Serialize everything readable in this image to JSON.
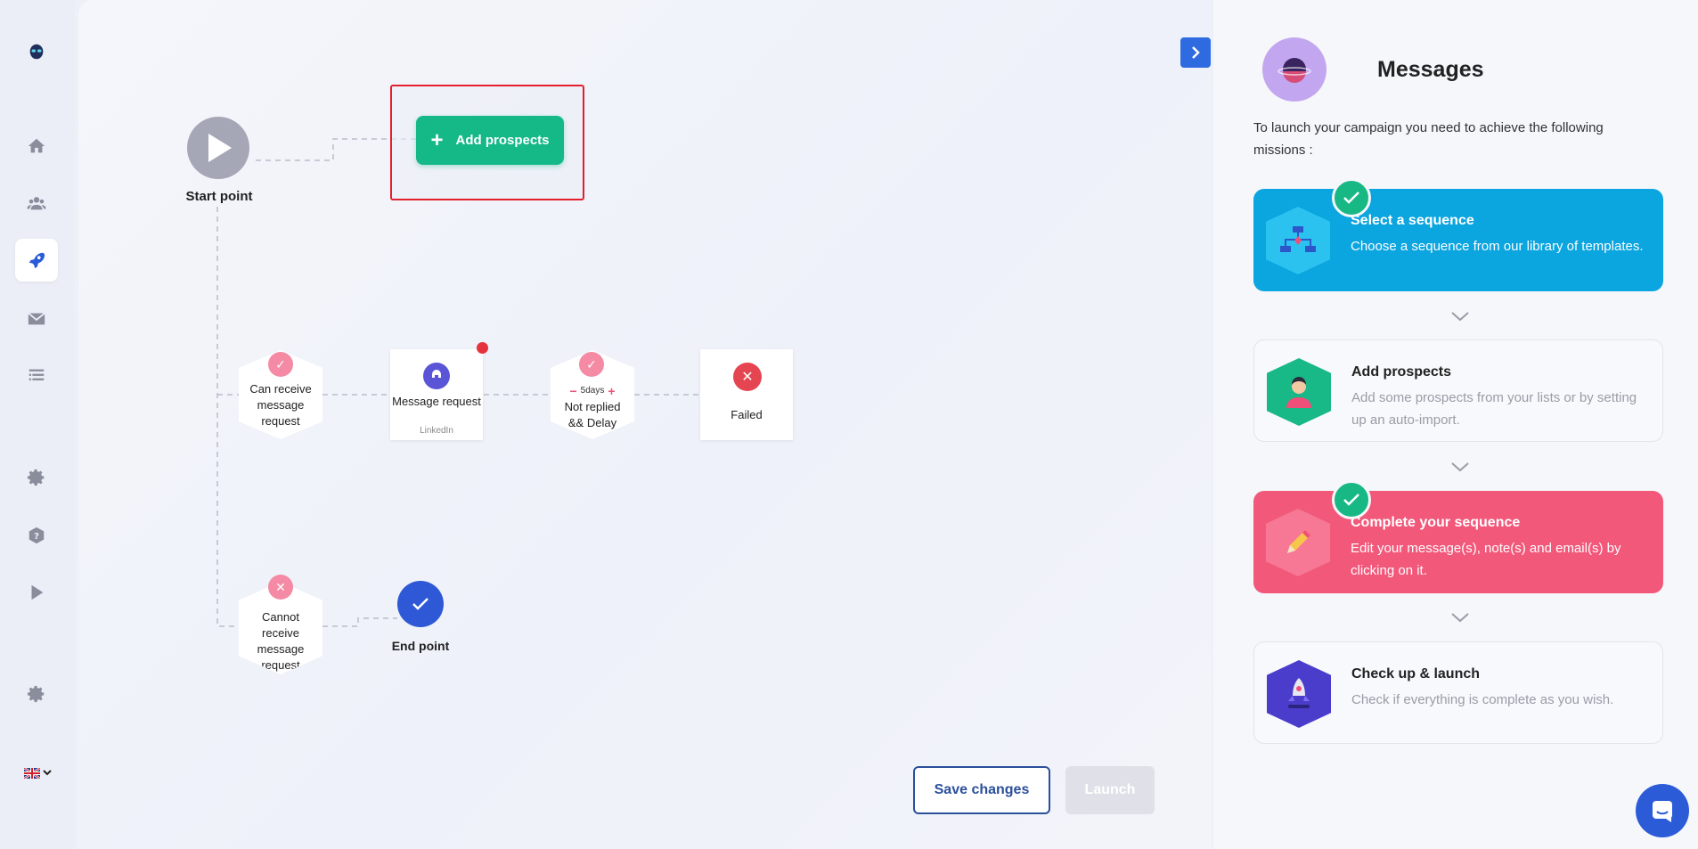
{
  "sidebar": {
    "items": [
      {
        "name": "logo",
        "icon": "alien-logo-icon"
      },
      {
        "name": "home",
        "icon": "home-icon"
      },
      {
        "name": "contacts",
        "icon": "users-icon"
      },
      {
        "name": "campaigns",
        "icon": "rocket-icon",
        "active": true
      },
      {
        "name": "inbox",
        "icon": "mail-icon"
      },
      {
        "name": "lists",
        "icon": "list-icon"
      },
      {
        "name": "settings",
        "icon": "gear-icon"
      },
      {
        "name": "help",
        "icon": "help-icon"
      },
      {
        "name": "tutorial",
        "icon": "play-icon"
      },
      {
        "name": "preferences",
        "icon": "gear-icon"
      }
    ],
    "language": "en-GB"
  },
  "flow": {
    "start_label": "Start point",
    "add_prospects_label": "Add prospects",
    "can_receive_label": "Can receive message request",
    "message_title": "Message request",
    "message_sub": "LinkedIn",
    "delay_value": "5days",
    "delay_label": "Not replied && Delay",
    "failed_label": "Failed",
    "cannot_receive_label": "Cannot receive message request",
    "end_label": "End point"
  },
  "actions": {
    "save_label": "Save changes",
    "launch_label": "Launch"
  },
  "panel": {
    "title": "Messages",
    "intro": "To launch your campaign you need to achieve the following missions :",
    "missions": [
      {
        "title": "Select a sequence",
        "desc": "Choose a sequence from our library of templates.",
        "state": "done",
        "color": "#0ba5df"
      },
      {
        "title": "Add prospects",
        "desc": "Add some prospects from your lists or by setting up an auto-import.",
        "state": "pending"
      },
      {
        "title": "Complete your sequence",
        "desc": "Edit your message(s), note(s) and email(s) by clicking on it.",
        "state": "done",
        "color": "#f2587a"
      },
      {
        "title": "Check up & launch",
        "desc": "Check if everything is complete as you wish.",
        "state": "pending"
      }
    ]
  },
  "colors": {
    "accent": "#2b5bd7",
    "green": "#15b887",
    "red": "#e54451",
    "pink": "#f2587a"
  }
}
